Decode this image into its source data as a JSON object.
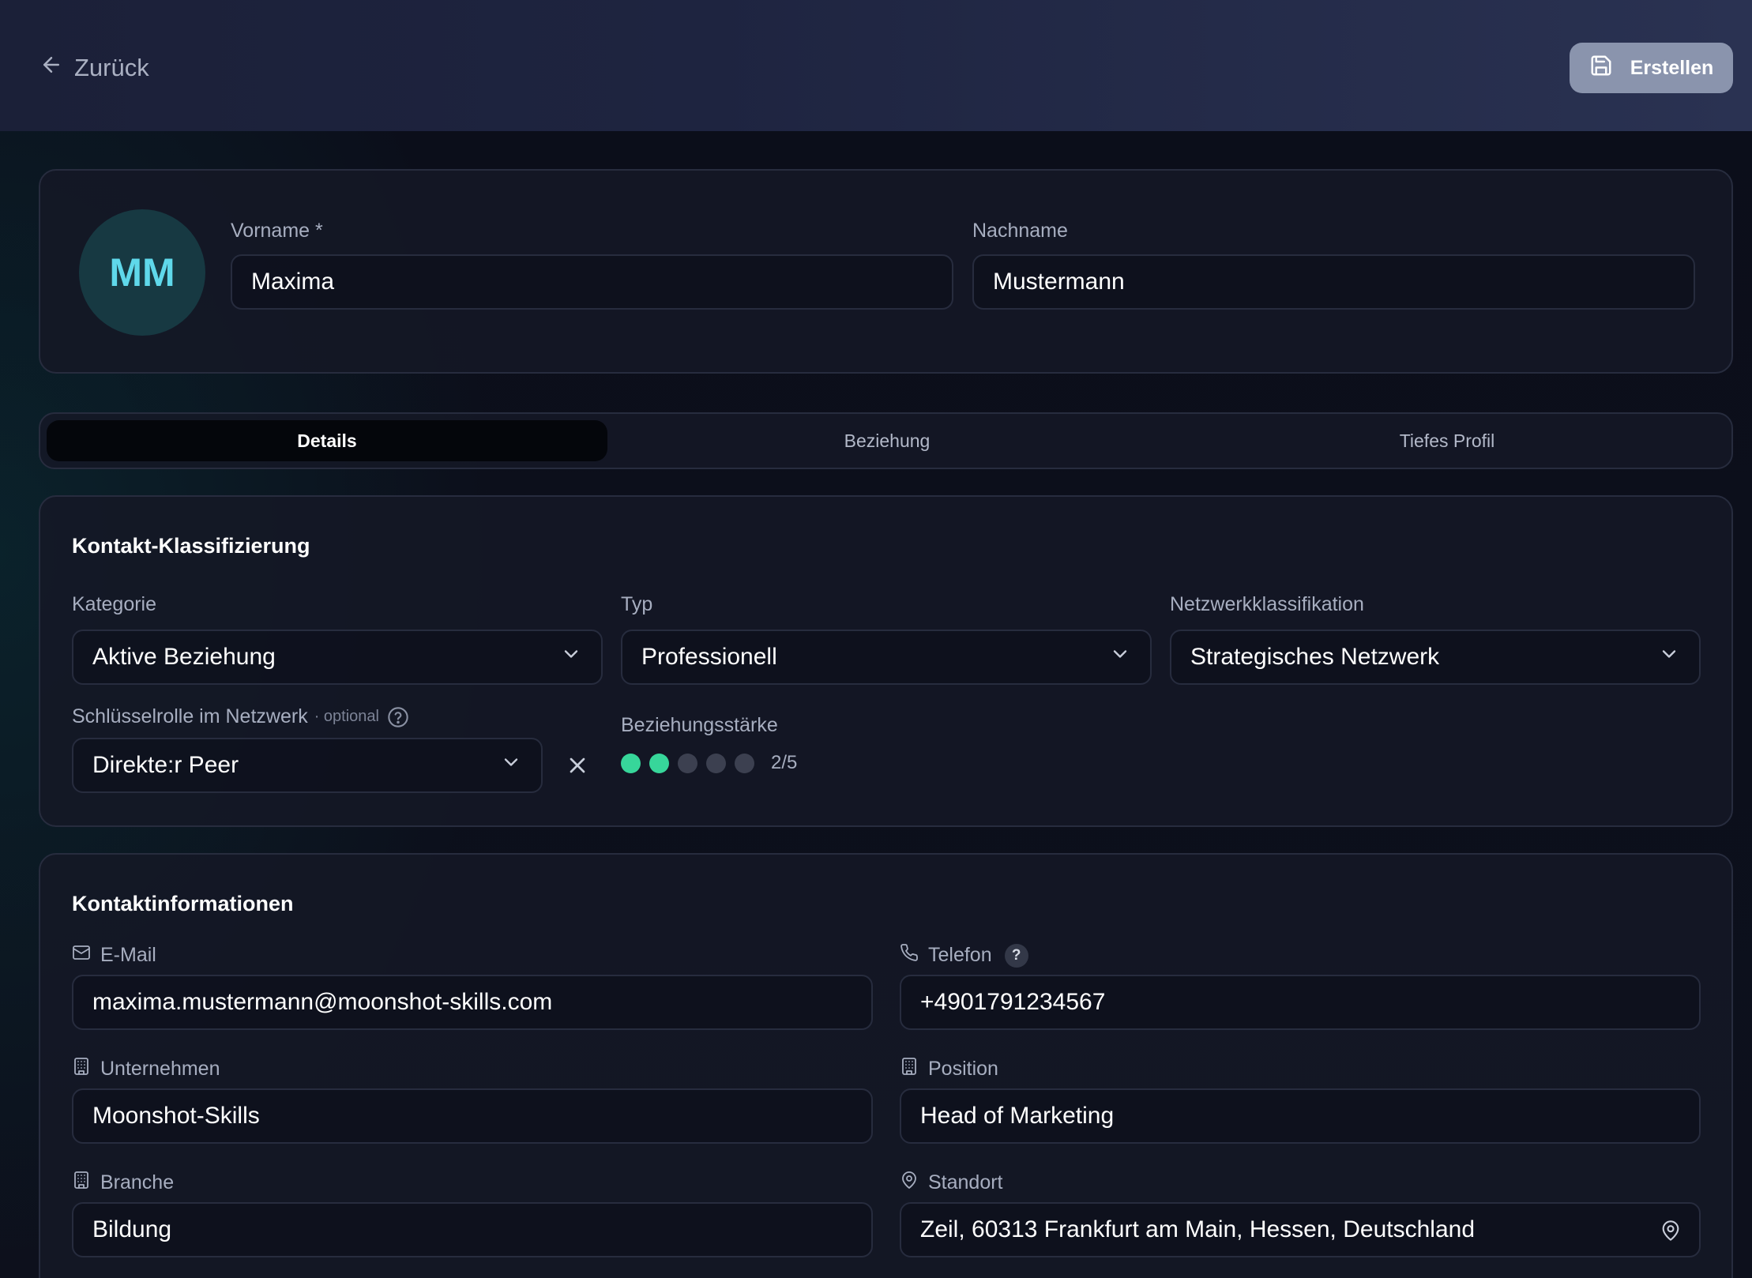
{
  "header": {
    "back_label": "Zurück",
    "create_label": "Erstellen"
  },
  "profile": {
    "initials": "MM",
    "first_name_label": "Vorname *",
    "first_name_value": "Maxima",
    "last_name_label": "Nachname",
    "last_name_value": "Mustermann"
  },
  "tabs": [
    {
      "label": "Details",
      "active": true
    },
    {
      "label": "Beziehung",
      "active": false
    },
    {
      "label": "Tiefes Profil",
      "active": false
    }
  ],
  "classification": {
    "title": "Kontakt-Klassifizierung",
    "category_label": "Kategorie",
    "category_value": "Aktive Beziehung",
    "type_label": "Typ",
    "type_value": "Professionell",
    "network_label": "Netzwerkklassifikation",
    "network_value": "Strategisches Netzwerk",
    "key_role_label": "Schlüsselrolle im Netzwerk",
    "key_role_optional": "· optional",
    "key_role_value": "Direkte:r Peer",
    "strength_label": "Beziehungsstärke",
    "strength_value": 2,
    "strength_max": 5,
    "strength_text": "2/5"
  },
  "contact": {
    "title": "Kontaktinformationen",
    "email_label": "E-Mail",
    "email_value": "maxima.mustermann@moonshot-skills.com",
    "phone_label": "Telefon",
    "phone_help": "?",
    "phone_value": "+4901791234567",
    "company_label": "Unternehmen",
    "company_value": "Moonshot-Skills",
    "position_label": "Position",
    "position_value": "Head of Marketing",
    "industry_label": "Branche",
    "industry_value": "Bildung",
    "location_label": "Standort",
    "location_value": "Zeil, 60313 Frankfurt am Main, Hessen, Deutschland"
  },
  "colors": {
    "accent_teal": "#5fd8ea",
    "strength_on": "#37d69a",
    "strength_off": "#3c4050",
    "create_button": "#8a94ad"
  },
  "icons": {
    "back": "arrow-left-icon",
    "create": "save-icon",
    "email": "mail-icon",
    "phone": "phone-icon",
    "company": "building-icon",
    "location": "map-pin-icon",
    "dropdown": "chevron-down-icon",
    "clear": "close-icon",
    "help": "help-circle-icon"
  }
}
